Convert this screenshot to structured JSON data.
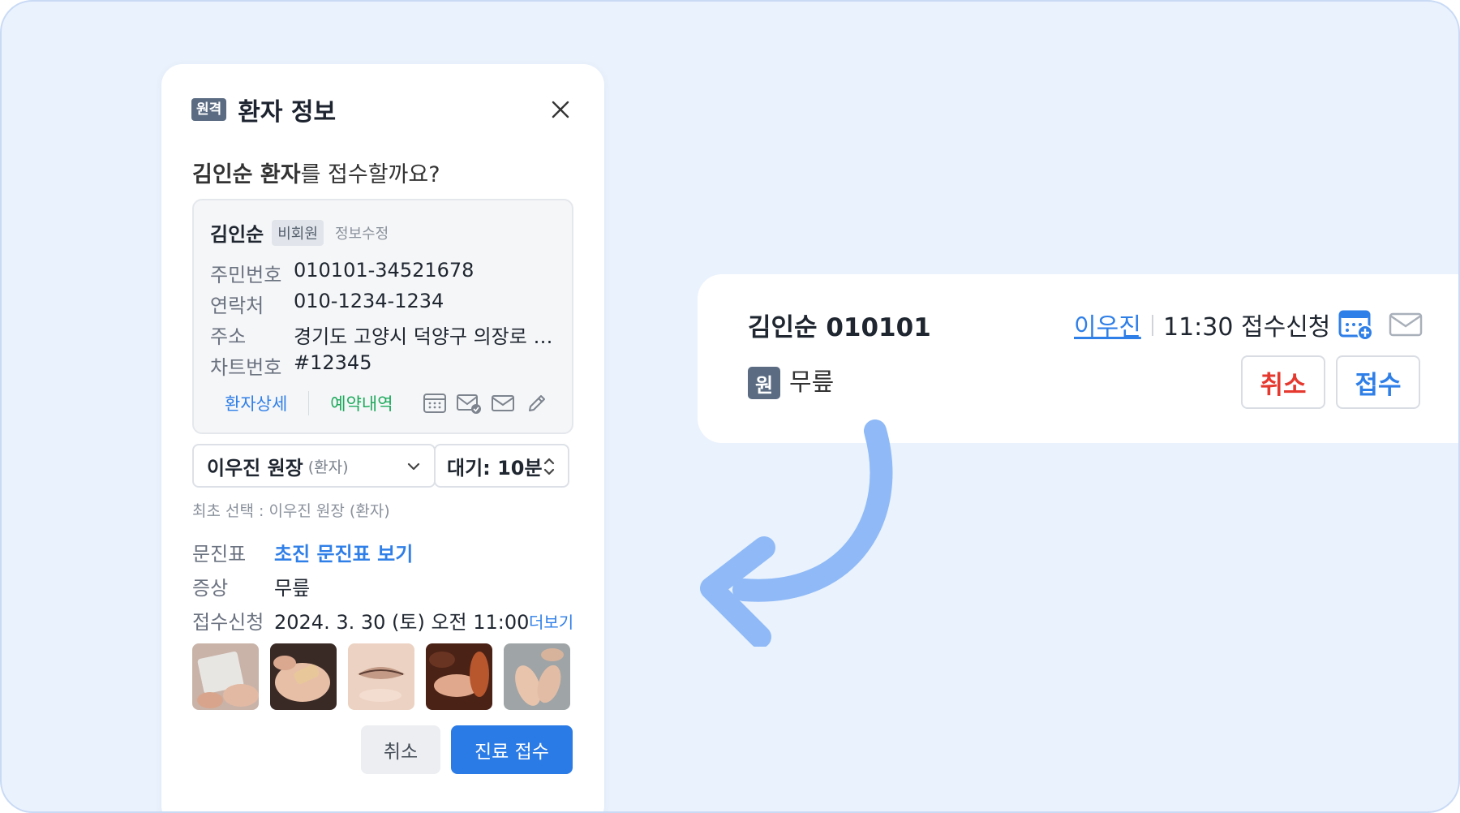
{
  "colors": {
    "background": "#eaf2fd",
    "accent_blue": "#2b7be6",
    "green": "#1eaa5c",
    "red": "#e5392f",
    "badge": "#5a6b82",
    "arrow": "#8fbaf7"
  },
  "modal": {
    "tag": "원격",
    "title": "환자 정보",
    "question_bold": "김인순 환자",
    "question_rest": "를 접수할까요?",
    "card": {
      "name": "김인순",
      "member_badge": "비회원",
      "edit_label": "정보수정",
      "rows": [
        {
          "label": "주민번호",
          "value": "010101-34521678"
        },
        {
          "label": "연락처",
          "value": "010-1234-1234"
        },
        {
          "label": "주소",
          "value": "경기도 고양시 덕양구 의장로 1…"
        },
        {
          "label": "차트번호",
          "value": "#12345"
        }
      ],
      "detail_link": "환자상세",
      "history_link": "예약내역",
      "icons": [
        "calendar-icon",
        "mail-check-icon",
        "mail-icon",
        "pencil-icon"
      ]
    },
    "doctor_select": {
      "main": "이우진 원장",
      "sub": "(환자)"
    },
    "wait_select": {
      "value": "대기: 10분"
    },
    "first_choice": "최초 선택 : 이우진 원장 (환자)",
    "questionnaire": {
      "label": "문진표",
      "link": "초진 문진표 보기"
    },
    "symptom": {
      "label": "증상",
      "value": "무릎"
    },
    "request": {
      "label": "접수신청",
      "value": "2024. 3. 30 (토) 오전 11:00",
      "more": "더보기"
    },
    "buttons": {
      "cancel": "취소",
      "confirm": "진료 접수"
    }
  },
  "list_card": {
    "name": "김인순 010101",
    "doctor": "이우진",
    "time_status": "11:30 접수신청",
    "badge": "원",
    "symptom": "무릎",
    "cancel": "취소",
    "accept": "접수"
  }
}
